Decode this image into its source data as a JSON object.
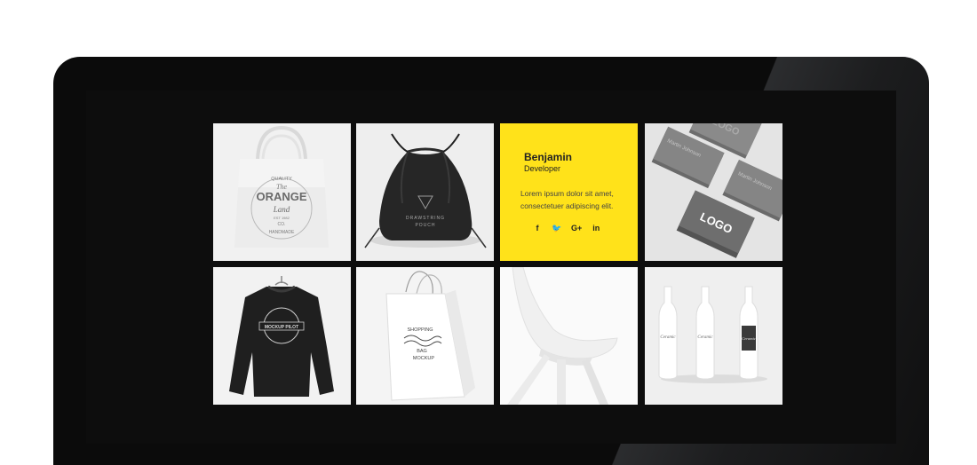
{
  "gallery": {
    "items": [
      {
        "label": "tote-bag",
        "text": [
          "QUALITY",
          "The",
          "ORANGE",
          "Land",
          "EST 1982",
          "CO.",
          "HANDMADE"
        ]
      },
      {
        "label": "drawstring-pouch",
        "text": [
          "DRAWSTRING",
          "POUCH"
        ]
      },
      {
        "label": "profile-card"
      },
      {
        "label": "business-cards",
        "text": [
          "LOGO",
          "LOGO",
          "Martin Johnson",
          "Martin Johnson"
        ]
      },
      {
        "label": "sweatshirt",
        "text": [
          "MOCKUP PILOT"
        ]
      },
      {
        "label": "shopping-bag",
        "text": [
          "SHOPPING",
          "BAG",
          "MOCKUP"
        ]
      },
      {
        "label": "chair"
      },
      {
        "label": "bottles",
        "text": [
          "Ceramic",
          "Ceramic",
          "Ceramic"
        ]
      }
    ]
  },
  "profile": {
    "name": "Benjamin",
    "role": "Developer",
    "description": "Lorem ipsum dolor sit amet, consectetuer adipiscing elit.",
    "socials": [
      {
        "icon": "facebook-icon",
        "glyph": "f"
      },
      {
        "icon": "twitter-icon",
        "glyph": "🐦"
      },
      {
        "icon": "google-plus-icon",
        "glyph": "G+"
      },
      {
        "icon": "linkedin-icon",
        "glyph": "in"
      }
    ]
  },
  "colors": {
    "accent": "#ffe21a",
    "monitor": "#0b0b0b",
    "tile": "#f2f2f2"
  }
}
